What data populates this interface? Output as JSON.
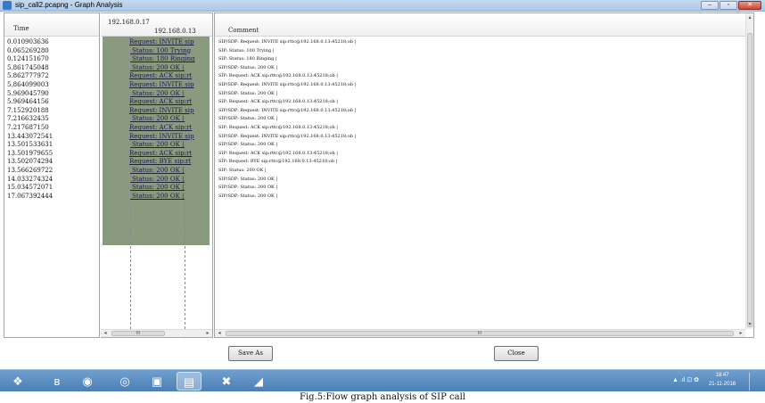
{
  "window": {
    "title": "sip_call2.pcapng - Graph Analysis",
    "min_glyph": "–",
    "max_glyph": "▫",
    "close_glyph": "✕"
  },
  "columns": {
    "time_header": "Time",
    "node_a": "192.168.0.17",
    "node_b": "192.168.0.13",
    "comment_header": "Comment"
  },
  "rows": [
    {
      "time": "0.010903636",
      "label": "Request: INVITE sip",
      "dir": "right",
      "comment": "SIP/SDP: Request: INVITE sip:rttc@192.168.0.13:45218;ob |"
    },
    {
      "time": "0.065269280",
      "label": "Status: 100 Trying",
      "dir": "left",
      "comment": "SIP: Status: 100 Trying |"
    },
    {
      "time": "0.124151670",
      "label": "Status: 180 Ringing",
      "dir": "left",
      "comment": "SIP: Status: 180 Ringing |"
    },
    {
      "time": "5.861745048",
      "label": "Status: 200 OK |",
      "dir": "left",
      "comment": "SIP/SDP: Status: 200 OK |"
    },
    {
      "time": "5.862777972",
      "label": "Request: ACK sip:rt",
      "dir": "right",
      "comment": "SIP: Request: ACK sip:rttc@192.168.0.13:45218;ob |"
    },
    {
      "time": "5.864099003",
      "label": "Request: INVITE sip",
      "dir": "right",
      "comment": "SIP/SDP: Request: INVITE sip:rttc@192.168.0.13:45218;ob |"
    },
    {
      "time": "5.969045790",
      "label": "Status: 200 OK |",
      "dir": "left",
      "comment": "SIP/SDP: Status: 200 OK |"
    },
    {
      "time": "5.969464156",
      "label": "Request: ACK sip:rt",
      "dir": "right",
      "comment": "SIP: Request: ACK sip:rttc@192.168.0.13:45218;ob |"
    },
    {
      "time": "7.152920188",
      "label": "Request: INVITE sip",
      "dir": "right",
      "comment": "SIP/SDP: Request: INVITE sip:rttc@192.168.0.13:45218;ob |"
    },
    {
      "time": "7.216632435",
      "label": "Status: 200 OK |",
      "dir": "left",
      "comment": "SIP/SDP: Status: 200 OK |"
    },
    {
      "time": "7.217687150",
      "label": "Request: ACK sip:rt",
      "dir": "right",
      "comment": "SIP: Request: ACK sip:rttc@192.168.0.13:45218;ob |"
    },
    {
      "time": "13.443072541",
      "label": "Request: INVITE sip",
      "dir": "right",
      "comment": "SIP/SDP: Request: INVITE sip:rttc@192.168.0.13:45218;ob |"
    },
    {
      "time": "13.501533631",
      "label": "Status: 200 OK |",
      "dir": "left",
      "comment": "SIP/SDP: Status: 200 OK |"
    },
    {
      "time": "13.501979655",
      "label": "Request: ACK sip:rt",
      "dir": "right",
      "comment": "SIP: Request: ACK sip:rttc@192.168.0.13:45218;ob |"
    },
    {
      "time": "13.502074294",
      "label": "Request: BYE sip:rt",
      "dir": "right",
      "comment": "SIP: Request: BYE sip:rttc@192.168.0.13:45218;ob |"
    },
    {
      "time": "13.566269722",
      "label": "Status: 200 OK |",
      "dir": "left",
      "comment": "SIP: Status: 200 OK |"
    },
    {
      "time": "14.033274324",
      "label": "Status: 200 OK |",
      "dir": "left",
      "comment": "SIP/SDP: Status: 200 OK |"
    },
    {
      "time": "15.034572071",
      "label": "Status: 200 OK |",
      "dir": "left",
      "comment": "SIP/SDP: Status: 200 OK |"
    },
    {
      "time": "17.067392444",
      "label": "Status: 200 OK |",
      "dir": "left",
      "comment": "SIP/SDP: Status: 200 OK |"
    }
  ],
  "scroll": {
    "flow_thumb": "III",
    "comment_thumb": "III",
    "left_arrow": "◂",
    "right_arrow": "▸",
    "up_arrow": "▴",
    "down_arrow": "▾"
  },
  "buttons": {
    "save_as": "Save As",
    "close": "Close"
  },
  "taskbar": {
    "items": [
      {
        "name": "start-button",
        "glyph": "❖",
        "active": false
      },
      {
        "name": "bluetooth-taskbar-icon",
        "glyph": "ʙ",
        "active": false
      },
      {
        "name": "firefox-taskbar-icon",
        "glyph": "◉",
        "active": false
      },
      {
        "name": "chrome-taskbar-icon",
        "glyph": "◎",
        "active": false
      },
      {
        "name": "screen-taskbar-icon",
        "glyph": "▣",
        "active": false
      },
      {
        "name": "folder-taskbar-icon",
        "glyph": "▤",
        "active": true
      },
      {
        "name": "tool-taskbar-icon",
        "glyph": "✖",
        "active": false
      },
      {
        "name": "wireshark-taskbar-icon",
        "glyph": "◢",
        "active": false
      }
    ],
    "tray_icons": "▲ .ıl ⊡ ✿",
    "time": "18:47",
    "date": "21-11-2016"
  },
  "caption": "Fig.5:Flow graph analysis of SIP call"
}
